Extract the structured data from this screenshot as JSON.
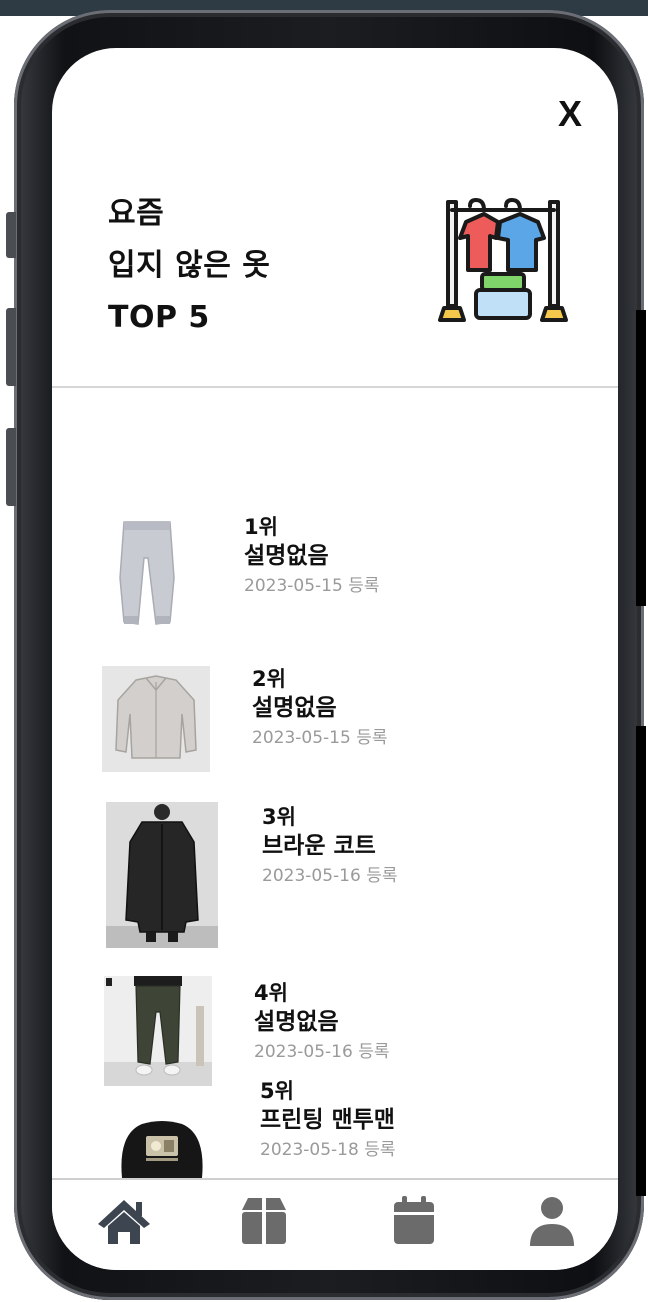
{
  "header": {
    "close_label": "X",
    "title_lines": [
      "요즘",
      "입지 않은 옷",
      "TOP 5"
    ]
  },
  "items": [
    {
      "rank": "1위",
      "name": "설명없음",
      "date": "2023-05-15 등록"
    },
    {
      "rank": "2위",
      "name": "설명없음",
      "date": "2023-05-15 등록"
    },
    {
      "rank": "3위",
      "name": "브라운 코트",
      "date": "2023-05-16 등록"
    },
    {
      "rank": "4위",
      "name": "설명없음",
      "date": "2023-05-16 등록"
    },
    {
      "rank": "5위",
      "name": "프린팅 맨투맨",
      "date": "2023-05-18 등록"
    }
  ],
  "nav": [
    {
      "icon": "home-icon"
    },
    {
      "icon": "box-icon"
    },
    {
      "icon": "calendar-icon"
    },
    {
      "icon": "user-icon"
    }
  ],
  "colors": {
    "text": "#111111",
    "date_text": "#9a9a9a",
    "nav_icon": "#6b6b6b",
    "nav_icon_active": "#3d4650"
  }
}
